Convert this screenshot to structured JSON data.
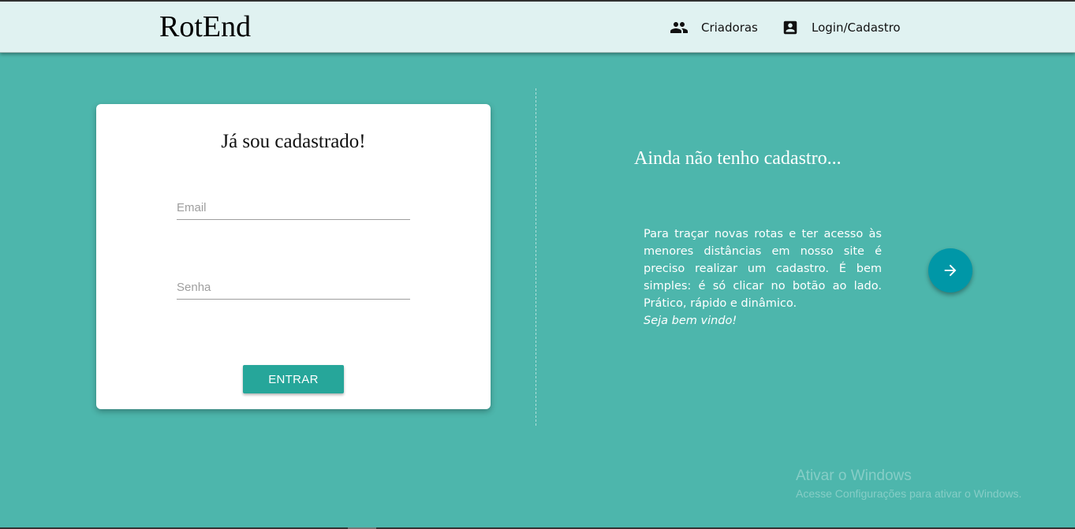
{
  "header": {
    "brand": "RotEnd",
    "nav": {
      "creators": {
        "label": "Criadoras",
        "icon": "people-icon"
      },
      "login": {
        "label": "Login/Cadastro",
        "icon": "account-box-icon"
      }
    }
  },
  "login_card": {
    "title": "Já sou cadastrado!",
    "email_placeholder": "Email",
    "password_placeholder": "Senha",
    "submit_label": "ENTRAR"
  },
  "signup": {
    "title": "Ainda não tenho cadastro...",
    "text": "Para traçar novas rotas e ter acesso às menores distâncias em nosso site é preciso realizar um cadastro. É bem simples: é só clicar no botão ao lado. Prático, rápido e dinâmico.",
    "text_emphasis": "Seja bem vindo!",
    "button_icon": "arrow-right-icon"
  },
  "watermark": {
    "title": "Ativar o Windows",
    "subtitle": "Acesse Configurações para ativar o Windows."
  },
  "colors": {
    "page_background": "#4db6ac",
    "navbar_background": "#e0f2f1",
    "button_teal": "#26a69a",
    "fab_cyan": "#0097a7"
  }
}
